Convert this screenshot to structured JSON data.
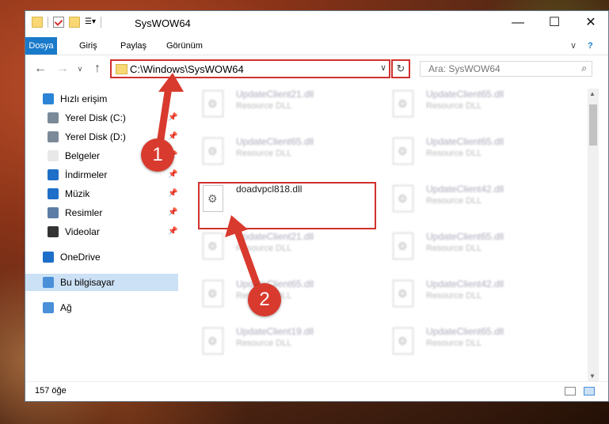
{
  "window": {
    "title": "SysWOW64",
    "minimize": "—",
    "maximize": "☐",
    "close": "✕"
  },
  "ribbon": {
    "tabs": [
      "Dosya",
      "Giriş",
      "Paylaş",
      "Görünüm"
    ],
    "expand": "∨",
    "help": "?"
  },
  "nav": {
    "back": "←",
    "forward": "→",
    "dropdown": "∨",
    "up": "↑",
    "address": "C:\\Windows\\SysWOW64",
    "address_dd": "∨",
    "refresh": "↻",
    "search_placeholder": "Ara: SysWOW64",
    "search_icon": "⌕"
  },
  "sidebar": [
    {
      "label": "Hızlı erişim",
      "icon": "star-icon",
      "color": "#2b84d6",
      "indent": 1,
      "pinned": false
    },
    {
      "label": "Yerel Disk (C:)",
      "icon": "drive-icon",
      "color": "#7b8a99",
      "indent": 2,
      "pinned": true
    },
    {
      "label": "Yerel Disk (D:)",
      "icon": "drive-icon",
      "color": "#7b8a99",
      "indent": 2,
      "pinned": true
    },
    {
      "label": "Belgeler",
      "icon": "document-icon",
      "color": "#e8e8e8",
      "indent": 2,
      "pinned": true
    },
    {
      "label": "İndirmeler",
      "icon": "download-icon",
      "color": "#1e6fc8",
      "indent": 2,
      "pinned": true
    },
    {
      "label": "Müzik",
      "icon": "music-icon",
      "color": "#1e6fc8",
      "indent": 2,
      "pinned": true
    },
    {
      "label": "Resimler",
      "icon": "pictures-icon",
      "color": "#5b7da6",
      "indent": 2,
      "pinned": true
    },
    {
      "label": "Videolar",
      "icon": "video-icon",
      "color": "#333333",
      "indent": 2,
      "pinned": true
    },
    {
      "label": "OneDrive",
      "icon": "onedrive-icon",
      "color": "#1e6fc8",
      "indent": 1,
      "pinned": false
    },
    {
      "label": "Bu bilgisayar",
      "icon": "computer-icon",
      "color": "#4a90d9",
      "indent": 1,
      "pinned": false
    },
    {
      "label": "Ağ",
      "icon": "network-icon",
      "color": "#4a90d9",
      "indent": 1,
      "pinned": false
    }
  ],
  "files": [
    {
      "name": "UpdateClient21.dll",
      "desc": "Resource DLL"
    },
    {
      "name": "UpdateClient65.dll",
      "desc": "Resource DLL"
    },
    {
      "name": "UpdateClient65.dll",
      "desc": "Resource DLL"
    },
    {
      "name": "UpdateClient65.dll",
      "desc": "Resource DLL"
    },
    {
      "name": "doadvpcl818.dll",
      "desc": ""
    },
    {
      "name": "UpdateClient42.dll",
      "desc": "Resource DLL"
    },
    {
      "name": "UpdateClient21.dll",
      "desc": "Resource DLL"
    },
    {
      "name": "UpdateClient65.dll",
      "desc": "Resource DLL"
    },
    {
      "name": "UpdateClient65.dll",
      "desc": "Resource DLL"
    },
    {
      "name": "UpdateClient42.dll",
      "desc": "Resource DLL"
    },
    {
      "name": "UpdateClient19.dll",
      "desc": "Resource DLL"
    },
    {
      "name": "UpdateClient65.dll",
      "desc": "Resource DLL"
    }
  ],
  "status": {
    "count": "157 öğe"
  },
  "annotations": [
    "1",
    "2"
  ],
  "colors": {
    "accent": "#1979ca",
    "highlight": "#d0312d"
  }
}
